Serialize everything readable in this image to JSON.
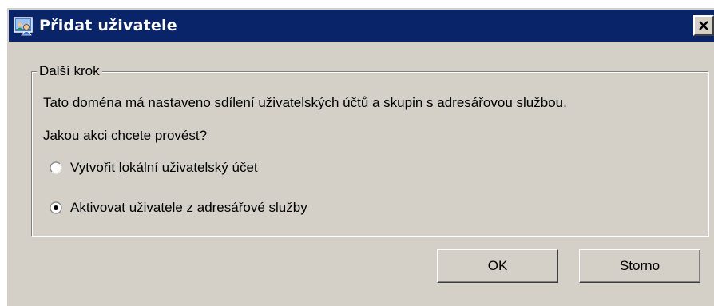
{
  "window": {
    "title": "Přidat uživatele",
    "title_bar_color": "#0a246a",
    "face_color": "#d4d0c8",
    "app_icon": "users-icon",
    "close_icon": "close-icon"
  },
  "group": {
    "legend": "Další krok",
    "description": "Tato doména má nastaveno sdílení uživatelských účtů a skupin s adresářovou službou.",
    "question": "Jakou akci chcete provést?",
    "options": [
      {
        "label_before": "Vytvořit ",
        "accel": "l",
        "label_after": "okální uživatelský účet",
        "selected": false
      },
      {
        "label_before": "",
        "accel": "A",
        "label_after": "ktivovat uživatele z adresářové služby",
        "selected": true
      }
    ]
  },
  "buttons": {
    "ok_label": "OK",
    "cancel_label": "Storno"
  }
}
